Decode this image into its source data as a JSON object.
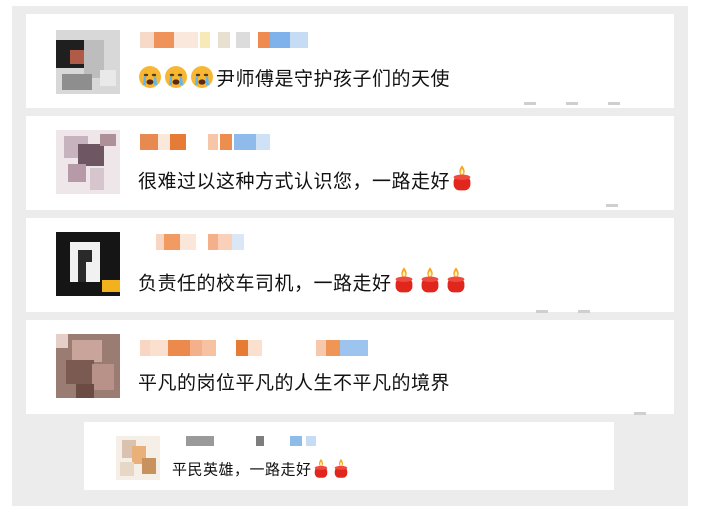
{
  "comments": [
    {
      "id": "c1",
      "text": "尹师傅是守护孩子们的天使",
      "emoji": "crying-face",
      "emoji_count": 3,
      "accent": "#f5a623"
    },
    {
      "id": "c2",
      "text": "很难过以这种方式认识您，一路走好",
      "emoji": "candle",
      "emoji_count": 1
    },
    {
      "id": "c3",
      "text": "负责任的校车司机，一路走好",
      "emoji": "candle",
      "emoji_count": 3
    },
    {
      "id": "c4",
      "text": "平凡的岗位平凡的人生不平凡的境界",
      "emoji": "none",
      "emoji_count": 0
    },
    {
      "id": "c5",
      "text": "平民英雄，一路走好",
      "emoji": "candle",
      "emoji_count": 2
    }
  ],
  "colors": {
    "background": "#ececec",
    "card": "#ffffff",
    "text": "#111111",
    "candle_body": "#e0261d",
    "candle_flame": "#f6a623"
  }
}
